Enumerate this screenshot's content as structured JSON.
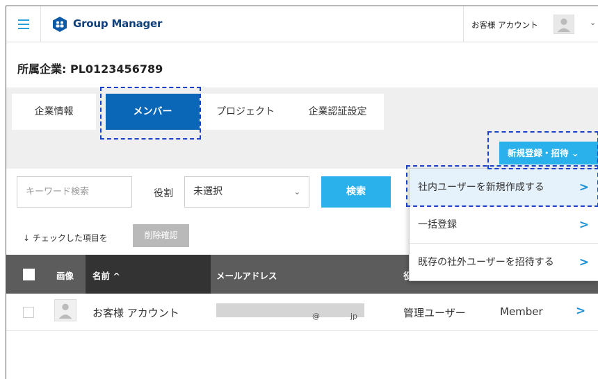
{
  "header": {
    "app_title": "Group Manager",
    "account_name": "お客様 アカウント",
    "menu_icon": "hamburger-icon",
    "logo_icon": "group-icon",
    "avatar_icon": "user-avatar-icon",
    "caret_icon": "chevron-down-icon"
  },
  "company": {
    "label": "所属企業: PL0123456789"
  },
  "tabs": [
    {
      "label": "企業情報",
      "active": false
    },
    {
      "label": "メンバー",
      "active": true
    },
    {
      "label": "プロジェクト",
      "active": false
    },
    {
      "label": "企業認証設定",
      "active": false
    }
  ],
  "actions": {
    "new_button": "新規登録・招待 ⌄"
  },
  "search": {
    "keyword_placeholder": "キーワード検索",
    "role_label": "役割",
    "role_selected": "未選択",
    "search_button": "検索"
  },
  "bulk": {
    "label": "↓ チェックした項目を",
    "delete_button": "削除確認"
  },
  "table": {
    "headers": {
      "image": "画像",
      "name": "名前 ^",
      "email": "メールアドレス",
      "role": "役"
    },
    "rows": [
      {
        "name": "お客様 アカウント",
        "email_visible": "@　　　　jp",
        "role": "管理ユーザー",
        "type": "Member"
      }
    ]
  },
  "dropdown": {
    "items": [
      {
        "label": "社内ユーザーを新規作成する",
        "highlighted": true
      },
      {
        "label": "一括登録",
        "highlighted": false
      },
      {
        "label": "既存の社外ユーザーを招待する",
        "highlighted": false
      }
    ]
  },
  "colors": {
    "primary_blue": "#0a66b7",
    "accent_cyan": "#2ab0ea",
    "header_navy": "#0e3f7a",
    "highlight_dash": "#1a3fc8"
  }
}
